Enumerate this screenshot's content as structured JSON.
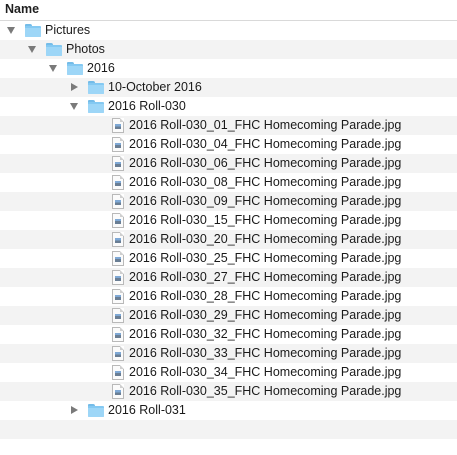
{
  "header": {
    "column_name": "Name"
  },
  "tree": [
    {
      "kind": "folder",
      "level": 0,
      "expanded": true,
      "label": "Pictures"
    },
    {
      "kind": "folder",
      "level": 1,
      "expanded": true,
      "label": "Photos"
    },
    {
      "kind": "folder",
      "level": 2,
      "expanded": true,
      "label": "2016"
    },
    {
      "kind": "folder",
      "level": 3,
      "expanded": false,
      "label": "10-October 2016"
    },
    {
      "kind": "folder",
      "level": 3,
      "expanded": true,
      "label": "2016 Roll-030"
    },
    {
      "kind": "file",
      "level": 4,
      "label": "2016 Roll-030_01_FHC Homecoming Parade.jpg"
    },
    {
      "kind": "file",
      "level": 4,
      "label": "2016 Roll-030_04_FHC Homecoming Parade.jpg"
    },
    {
      "kind": "file",
      "level": 4,
      "label": "2016 Roll-030_06_FHC Homecoming Parade.jpg"
    },
    {
      "kind": "file",
      "level": 4,
      "label": "2016 Roll-030_08_FHC Homecoming Parade.jpg"
    },
    {
      "kind": "file",
      "level": 4,
      "label": "2016 Roll-030_09_FHC Homecoming Parade.jpg"
    },
    {
      "kind": "file",
      "level": 4,
      "label": "2016 Roll-030_15_FHC Homecoming Parade.jpg"
    },
    {
      "kind": "file",
      "level": 4,
      "label": "2016 Roll-030_20_FHC Homecoming Parade.jpg"
    },
    {
      "kind": "file",
      "level": 4,
      "label": "2016 Roll-030_25_FHC Homecoming Parade.jpg"
    },
    {
      "kind": "file",
      "level": 4,
      "label": "2016 Roll-030_27_FHC Homecoming Parade.jpg"
    },
    {
      "kind": "file",
      "level": 4,
      "label": "2016 Roll-030_28_FHC Homecoming Parade.jpg"
    },
    {
      "kind": "file",
      "level": 4,
      "label": "2016 Roll-030_29_FHC Homecoming Parade.jpg"
    },
    {
      "kind": "file",
      "level": 4,
      "label": "2016 Roll-030_32_FHC Homecoming Parade.jpg"
    },
    {
      "kind": "file",
      "level": 4,
      "label": "2016 Roll-030_33_FHC Homecoming Parade.jpg"
    },
    {
      "kind": "file",
      "level": 4,
      "label": "2016 Roll-030_34_FHC Homecoming Parade.jpg"
    },
    {
      "kind": "file",
      "level": 4,
      "label": "2016 Roll-030_35_FHC Homecoming Parade.jpg"
    },
    {
      "kind": "folder",
      "level": 3,
      "expanded": false,
      "label": "2016 Roll-031"
    },
    {
      "kind": "empty"
    },
    {
      "kind": "empty"
    }
  ]
}
